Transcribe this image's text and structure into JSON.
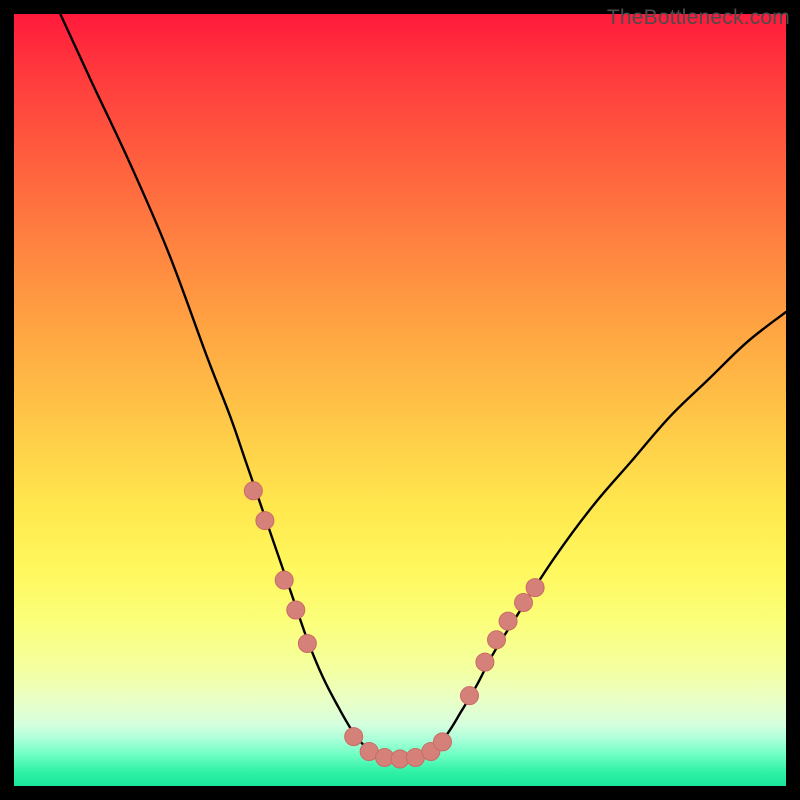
{
  "watermark": "TheBottleneck.com",
  "colors": {
    "curve": "#000000",
    "marker_fill": "#d5817a",
    "marker_stroke": "#c96b63"
  },
  "chart_data": {
    "type": "line",
    "title": "",
    "xlabel": "",
    "ylabel": "",
    "xlim": [
      0,
      100
    ],
    "ylim": [
      0,
      100
    ],
    "grid": false,
    "legend": false,
    "annotations": [],
    "series": [
      {
        "name": "bottleneck-curve",
        "x": [
          6,
          10,
          15,
          20,
          25,
          28,
          30,
          32,
          34,
          36,
          38,
          40,
          42,
          44,
          46,
          48,
          50,
          52,
          54,
          56,
          58,
          60,
          62,
          65,
          70,
          75,
          80,
          85,
          90,
          95,
          100
        ],
        "values": [
          100,
          91,
          80,
          68,
          54,
          46,
          40,
          34,
          28,
          22,
          16,
          11,
          7,
          3.5,
          1.2,
          0.3,
          0,
          0.3,
          1.2,
          3.2,
          6.5,
          10,
          14,
          19,
          27,
          34,
          40,
          46,
          51,
          56,
          60
        ]
      }
    ],
    "markers": [
      {
        "series": "bottleneck-curve",
        "x": 31,
        "y": 36
      },
      {
        "series": "bottleneck-curve",
        "x": 32.5,
        "y": 32
      },
      {
        "series": "bottleneck-curve",
        "x": 35,
        "y": 24
      },
      {
        "series": "bottleneck-curve",
        "x": 36.5,
        "y": 20
      },
      {
        "series": "bottleneck-curve",
        "x": 38,
        "y": 15.5
      },
      {
        "series": "bottleneck-curve",
        "x": 44,
        "y": 3
      },
      {
        "series": "bottleneck-curve",
        "x": 46,
        "y": 1
      },
      {
        "series": "bottleneck-curve",
        "x": 48,
        "y": 0.2
      },
      {
        "series": "bottleneck-curve",
        "x": 50,
        "y": 0
      },
      {
        "series": "bottleneck-curve",
        "x": 52,
        "y": 0.2
      },
      {
        "series": "bottleneck-curve",
        "x": 54,
        "y": 1
      },
      {
        "series": "bottleneck-curve",
        "x": 55.5,
        "y": 2.3
      },
      {
        "series": "bottleneck-curve",
        "x": 59,
        "y": 8.5
      },
      {
        "series": "bottleneck-curve",
        "x": 61,
        "y": 13
      },
      {
        "series": "bottleneck-curve",
        "x": 62.5,
        "y": 16
      },
      {
        "series": "bottleneck-curve",
        "x": 64,
        "y": 18.5
      },
      {
        "series": "bottleneck-curve",
        "x": 66,
        "y": 21
      },
      {
        "series": "bottleneck-curve",
        "x": 67.5,
        "y": 23
      }
    ]
  }
}
